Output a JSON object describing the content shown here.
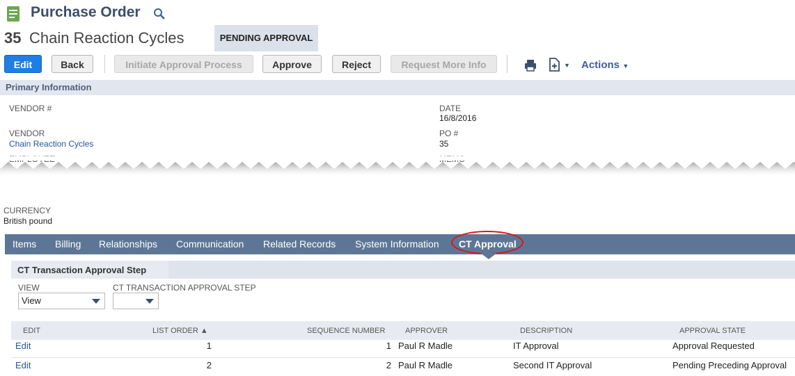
{
  "header": {
    "title": "Purchase Order",
    "record_id": "35",
    "record_name": "Chain Reaction Cycles",
    "status": "PENDING APPROVAL"
  },
  "toolbar": {
    "edit": "Edit",
    "back": "Back",
    "initiate": "Initiate Approval Process",
    "approve": "Approve",
    "reject": "Reject",
    "request_info": "Request More Info",
    "actions": "Actions"
  },
  "primary": {
    "section_title": "Primary Information",
    "vendor_num_label": "VENDOR #",
    "vendor_label": "VENDOR",
    "vendor_value": "Chain Reaction Cycles",
    "employee_label": "EMPLOYEE",
    "currency_label": "CURRENCY",
    "currency_value": "British pound",
    "date_label": "DATE",
    "date_value": "16/8/2016",
    "po_label": "PO #",
    "po_value": "35",
    "memo_label": "MEMO"
  },
  "tabs": [
    "Items",
    "Billing",
    "Relationships",
    "Communication",
    "Related Records",
    "System Information",
    "CT Approval"
  ],
  "subtab": {
    "label": "CT Transaction Approval Step",
    "view_label": "VIEW",
    "view_value": "View",
    "step_label": "CT TRANSACTION APPROVAL STEP",
    "step_value": ""
  },
  "table": {
    "headers": [
      "EDIT",
      "LIST ORDER ▲",
      "SEQUENCE NUMBER",
      "APPROVER",
      "DESCRIPTION",
      "APPROVAL STATE"
    ],
    "rows": [
      {
        "edit": "Edit",
        "list_order": "1",
        "sequence": "1",
        "approver": "Paul R Madle",
        "description": "IT Approval",
        "state": "Approval Requested"
      },
      {
        "edit": "Edit",
        "list_order": "2",
        "sequence": "2",
        "approver": "Paul R Madle",
        "description": "Second IT Approval",
        "state": "Pending Preceding Approval"
      }
    ]
  },
  "colors": {
    "brand": "#3d4e6a",
    "primary_button": "#1e7ee6",
    "tab_bar": "#5e7696",
    "highlight_circle": "#d8151c",
    "link": "#25569b"
  }
}
